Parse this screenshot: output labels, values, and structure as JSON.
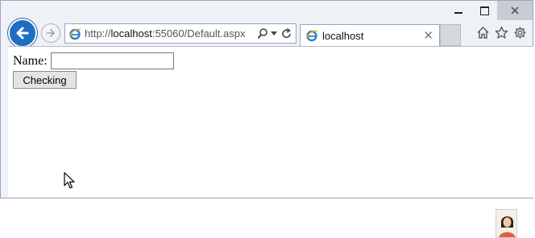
{
  "browser": {
    "address_bar": {
      "url_prefix": "http://",
      "url_host": "localhost",
      "url_rest": ":55060/Default.aspx"
    },
    "tab": {
      "label": "localhost",
      "close_glyph": "✕"
    },
    "icons": [
      "back-arrow-icon",
      "forward-arrow-icon",
      "ie-icon",
      "search-icon",
      "dropdown-icon",
      "refresh-icon",
      "home-icon",
      "favorites-star-icon",
      "settings-gear-icon"
    ],
    "accent_color": "#1e6fc2"
  },
  "page": {
    "name_label": "Name:",
    "name_input_value": "",
    "checking_button_label": "Checking"
  }
}
